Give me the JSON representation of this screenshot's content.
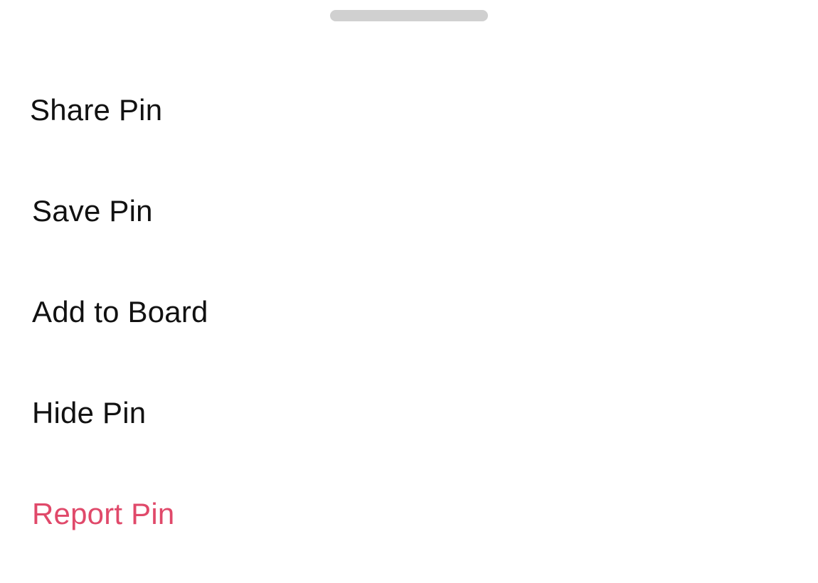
{
  "sheet": {
    "items": [
      {
        "label": "Share Pin"
      },
      {
        "label": "Save Pin"
      },
      {
        "label": "Add to Board"
      },
      {
        "label": "Hide Pin"
      },
      {
        "label": "Report Pin"
      }
    ]
  },
  "colors": {
    "text": "#111111",
    "danger": "#e0496a",
    "handle": "#d0d0d0",
    "background": "#ffffff"
  }
}
